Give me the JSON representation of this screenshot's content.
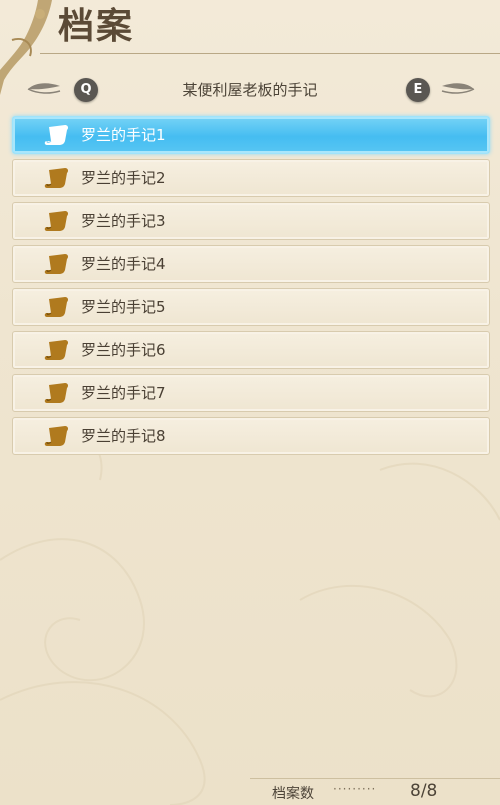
{
  "header": {
    "title": "档案"
  },
  "nav": {
    "prev_key": "Q",
    "next_key": "E",
    "category": "某便利屋老板的手记"
  },
  "records": [
    {
      "label": "罗兰的手记1",
      "selected": true
    },
    {
      "label": "罗兰的手记2",
      "selected": false
    },
    {
      "label": "罗兰的手记3",
      "selected": false
    },
    {
      "label": "罗兰的手记4",
      "selected": false
    },
    {
      "label": "罗兰的手记5",
      "selected": false
    },
    {
      "label": "罗兰的手记6",
      "selected": false
    },
    {
      "label": "罗兰的手记7",
      "selected": false
    },
    {
      "label": "罗兰的手记8",
      "selected": false
    }
  ],
  "footer": {
    "count_label": "档案数",
    "dots": "·········",
    "count_value": "8/8"
  },
  "colors": {
    "selected_row": "#45bdf1",
    "scroll_icon": "#b07a1e",
    "selected_scroll_icon": "#ffffff",
    "key_badge": "#5a5752"
  },
  "icons": {
    "nav_ornament": "feather-icon",
    "record": "scroll-icon",
    "nav_key": "key-icon"
  }
}
